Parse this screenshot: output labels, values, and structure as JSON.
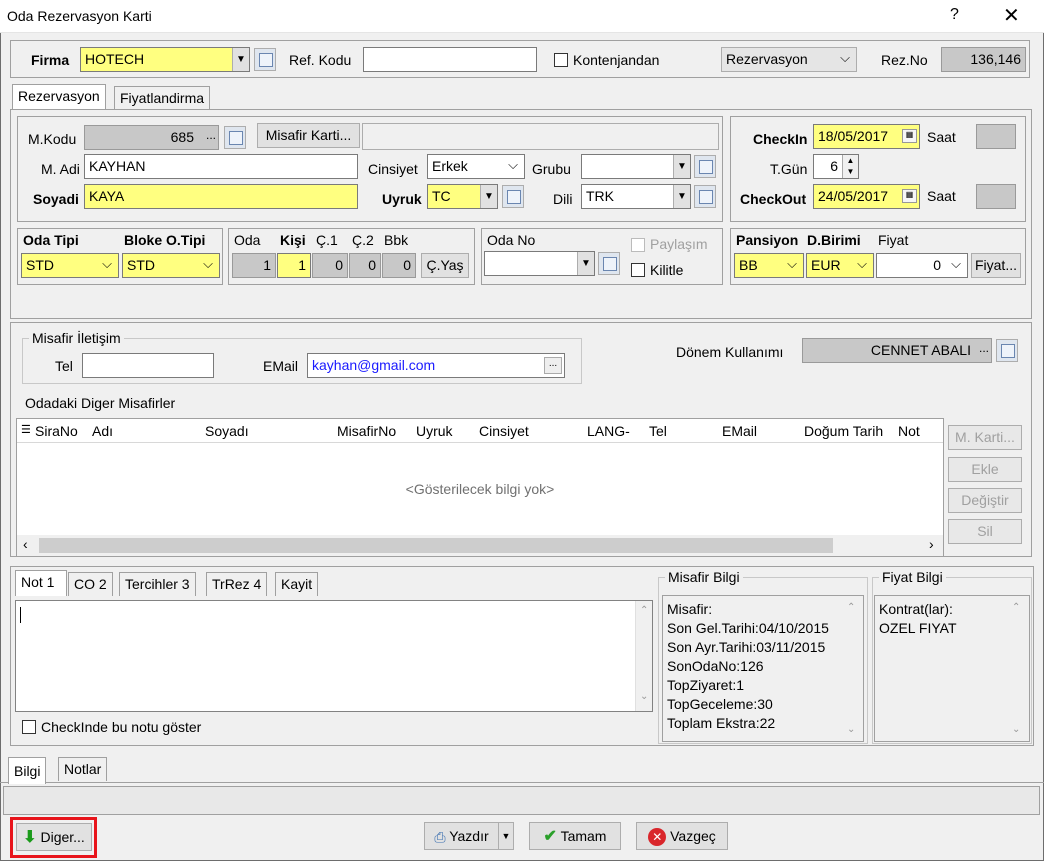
{
  "window": {
    "title": "Oda Rezervasyon Karti",
    "help": "?",
    "close": "✕"
  },
  "top": {
    "firma_label": "Firma",
    "firma_value": "HOTECH",
    "ref_label": "Ref. Kodu",
    "ref_value": "",
    "kontenjandan_label": "Kontenjandan",
    "type_value": "Rezervasyon",
    "rezno_label": "Rez.No",
    "rezno_value": "136,146"
  },
  "tabs": [
    "Rezervasyon",
    "Fiyatlandirma"
  ],
  "guest": {
    "mkodu_label": "M.Kodu",
    "mkodu_value": "685",
    "misafir_karti_button": "Misafir Karti...",
    "madi_label": "M. Adi",
    "madi_value": "KAYHAN",
    "cinsiyet_label": "Cinsiyet",
    "cinsiyet_value": "Erkek",
    "grubu_label": "Grubu",
    "grubu_value": "",
    "soyadi_label": "Soyadi",
    "soyadi_value": "KAYA",
    "uyruk_label": "Uyruk",
    "uyruk_value": "TC",
    "dili_label": "Dili",
    "dili_value": "TRK"
  },
  "dates": {
    "checkin_label": "CheckIn",
    "checkin_value": "18/05/2017",
    "saat_label": "Saat",
    "tgun_label": "T.Gün",
    "tgun_value": "6",
    "checkout_label": "CheckOut",
    "checkout_value": "24/05/2017"
  },
  "room": {
    "odatipi_label": "Oda Tipi",
    "odatipi_value": "STD",
    "bloke_label": "Bloke O.Tipi",
    "bloke_value": "STD",
    "oda_label": "Oda",
    "oda_value": "1",
    "kisi_label": "Kişi",
    "kisi_value": "1",
    "c1_label": "Ç.1",
    "c1_value": "0",
    "c2_label": "Ç.2",
    "c2_value": "0",
    "bbk_label": "Bbk",
    "bbk_value": "0",
    "cyas_button": "Ç.Yaş",
    "odano_label": "Oda No",
    "odano_value": "",
    "paylasim_label": "Paylaşım",
    "kilitle_label": "Kilitle"
  },
  "pricing": {
    "pansiyon_label": "Pansiyon",
    "pansiyon_value": "BB",
    "dbirimi_label": "D.Birimi",
    "dbirimi_value": "EUR",
    "fiyat_label": "Fiyat",
    "fiyat_value": "0",
    "fiyat_button": "Fiyat..."
  },
  "contact": {
    "group_title": "Misafir İletişim",
    "tel_label": "Tel",
    "tel_value": "",
    "email_label": "EMail",
    "email_value": "kayhan@gmail.com",
    "donem_label": "Dönem Kullanımı",
    "donem_value": "CENNET ABALI"
  },
  "others": {
    "group_title": "Odadaki Diger Misafirler",
    "columns": [
      "SiraNo",
      "Adı",
      "Soyadı",
      "MisafirNo",
      "Uyruk",
      "Cinsiyet",
      "LANG-",
      "Tel",
      "EMail",
      "Doğum Tarih",
      "Not"
    ],
    "empty_text": "<Gösterilecek bilgi yok>",
    "buttons": [
      "M. Karti...",
      "Ekle",
      "Değiştir",
      "Sil"
    ]
  },
  "notes": {
    "tabs": [
      "Not 1",
      "CO 2",
      "Tercihler 3",
      "TrRez 4",
      "Kayit"
    ],
    "text": "",
    "show_checkin_label": "CheckInde bu notu göster"
  },
  "misafir_bilgi": {
    "title": "Misafir Bilgi",
    "lines": [
      "Misafir:",
      "Son Gel.Tarihi:04/10/2015",
      "Son Ayr.Tarihi:03/11/2015",
      "SonOdaNo:126",
      "TopZiyaret:1",
      "TopGeceleme:30",
      "Toplam Ekstra:22"
    ]
  },
  "fiyat_bilgi": {
    "title": "Fiyat Bilgi",
    "lines": [
      "Kontrat(lar):",
      "OZEL FIYAT"
    ]
  },
  "bottom_tabs": [
    "Bilgi",
    "Notlar"
  ],
  "footer": {
    "diger_button": "Diger...",
    "yazdir_button": "Yazdır",
    "tamam_button": "Tamam",
    "vazgec_button": "Vazgeç"
  },
  "colors": {
    "highlight": "#ffff80",
    "focus_box": "#e8141b",
    "email_text": "#1a1aff"
  }
}
